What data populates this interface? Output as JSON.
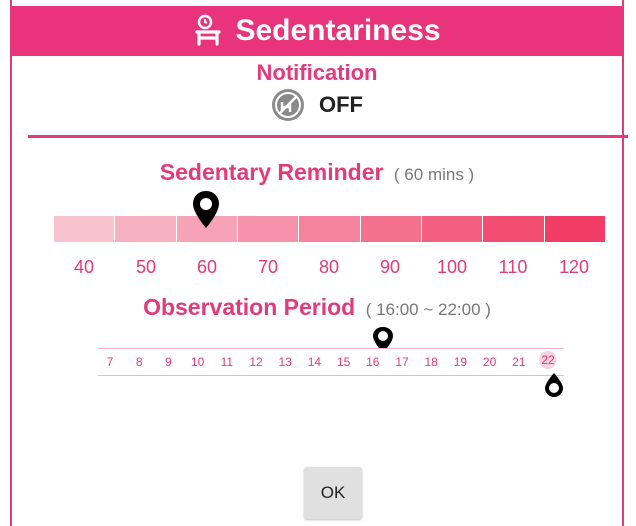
{
  "title": {
    "text": "Sedentariness",
    "icon": "chair-alarm-icon"
  },
  "notification": {
    "label": "Notification",
    "state": "OFF",
    "icon": "notification-off-icon"
  },
  "reminder": {
    "title": "Sedentary Reminder",
    "subtitle": "( 60 mins )",
    "value": 60,
    "labels": [
      "40",
      "50",
      "60",
      "70",
      "80",
      "90",
      "100",
      "110",
      "120"
    ],
    "segment_colors": [
      "#f8c3cf",
      "#f7b2c2",
      "#f6a3b7",
      "#f693ab",
      "#f5839d",
      "#f4718e",
      "#f25f80",
      "#f24e72",
      "#f13d65"
    ]
  },
  "observation": {
    "title": "Observation Period",
    "subtitle": "( 16:00 ~ 22:00 )",
    "start": 16,
    "end": 22,
    "hours": [
      "7",
      "8",
      "9",
      "10",
      "11",
      "12",
      "13",
      "14",
      "15",
      "16",
      "17",
      "18",
      "19",
      "20",
      "21",
      "22"
    ]
  },
  "ok_button": {
    "label": "OK"
  },
  "colors": {
    "accent": "#e9337c",
    "accent_text": "#e23a7a"
  }
}
